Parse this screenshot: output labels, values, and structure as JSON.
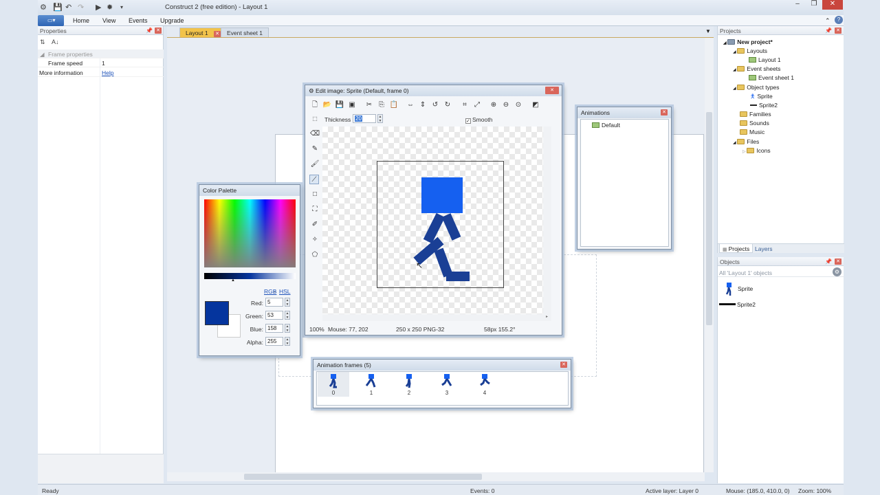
{
  "app": {
    "title": "Construct 2  (free edition) - Layout 1",
    "window_controls": [
      "–",
      "❐",
      "✕"
    ]
  },
  "ribbon": {
    "tabs": [
      "Home",
      "View",
      "Events",
      "Upgrade"
    ]
  },
  "properties": {
    "header": "Properties",
    "section": "Frame properties",
    "rows": [
      {
        "name": "Frame speed",
        "value": "1"
      },
      {
        "name": "More information",
        "value": "Help"
      }
    ]
  },
  "editor_tabs": [
    "Layout 1",
    "Event sheet 1"
  ],
  "edit_image": {
    "title": "Edit image: Sprite (Default, frame 0)",
    "thickness_label": "Thickness",
    "thickness_value": "20",
    "smooth_label": "Smooth",
    "status": {
      "zoom": "100%",
      "mouse": "Mouse: 77, 202",
      "size": "250 x 250  PNG-32",
      "line": "58px 155.2°"
    }
  },
  "color_palette": {
    "title": "Color Palette",
    "mode_rgb": "RGB",
    "mode_sep": " - ",
    "mode_hsl": "HSL",
    "fields": [
      {
        "label": "Red:",
        "value": "5"
      },
      {
        "label": "Green:",
        "value": "53"
      },
      {
        "label": "Blue:",
        "value": "158"
      },
      {
        "label": "Alpha:",
        "value": "255"
      }
    ],
    "current_color": "#05359e"
  },
  "animations": {
    "title": "Animations",
    "items": [
      "Default"
    ]
  },
  "animation_frames": {
    "title": "Animation frames (5)",
    "frames": [
      "0",
      "1",
      "2",
      "3",
      "4"
    ]
  },
  "projects": {
    "header": "Projects",
    "tree": [
      {
        "label": "New project*",
        "depth": 0,
        "icon": "project-icon",
        "bold": true
      },
      {
        "label": "Layouts",
        "depth": 1,
        "icon": "folder-icon"
      },
      {
        "label": "Layout 1",
        "depth": 2,
        "icon": "layout-icon"
      },
      {
        "label": "Event sheets",
        "depth": 1,
        "icon": "folder-icon"
      },
      {
        "label": "Event sheet 1",
        "depth": 2,
        "icon": "event-sheet-icon"
      },
      {
        "label": "Object types",
        "depth": 1,
        "icon": "folder-icon"
      },
      {
        "label": "Sprite",
        "depth": 2,
        "icon": "sprite-icon"
      },
      {
        "label": "Sprite2",
        "depth": 2,
        "icon": "sprite2-icon"
      },
      {
        "label": "Families",
        "depth": 1,
        "icon": "folder-icon"
      },
      {
        "label": "Sounds",
        "depth": 1,
        "icon": "folder-icon"
      },
      {
        "label": "Music",
        "depth": 1,
        "icon": "folder-icon"
      },
      {
        "label": "Files",
        "depth": 1,
        "icon": "folder-icon"
      },
      {
        "label": "Icons",
        "depth": 2,
        "icon": "folder-icon"
      }
    ],
    "tabs": [
      "Projects",
      "Layers"
    ]
  },
  "objects": {
    "header": "Objects",
    "filter_placeholder": "All 'Layout 1' objects",
    "items": [
      "Sprite",
      "Sprite2"
    ]
  },
  "statusbar": {
    "ready": "Ready",
    "events": "Events: 0",
    "active_layer": "Active layer: Layer 0",
    "mouse": "Mouse: (185.0, 410.0, 0)",
    "zoom": "Zoom: 100%"
  },
  "colors": {
    "sprite_head": "#1560f0",
    "sprite_body": "#1a3f95",
    "accent_tab": "#f2c34a"
  }
}
